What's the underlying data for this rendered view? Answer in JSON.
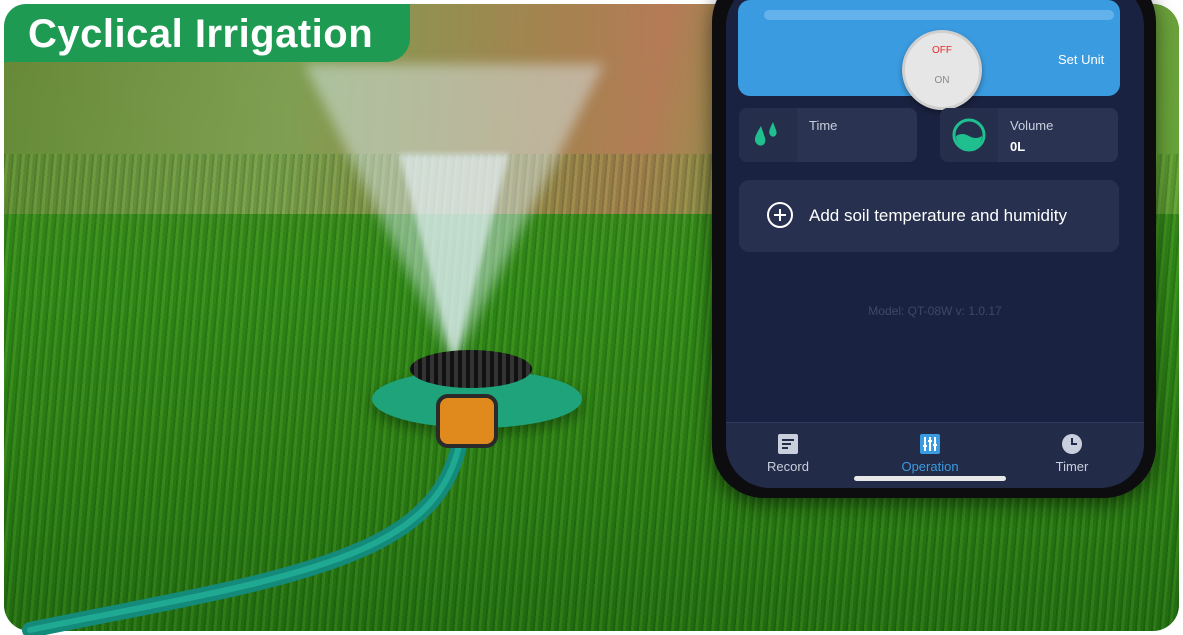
{
  "banner": {
    "title": "Cyclical Irrigation"
  },
  "device": {
    "power_toggle": {
      "off_label": "OFF",
      "on_label": "ON",
      "state": "off"
    },
    "set_unit_label": "Set Unit",
    "stats": [
      {
        "label": "Time",
        "value": "",
        "icon": "water-drops-icon"
      },
      {
        "label": "Volume",
        "value": "0L",
        "icon": "water-level-icon"
      }
    ],
    "add_sensor_label": "Add soil temperature and humidity",
    "model_text": "Model: QT-08W v: 1.0.17"
  },
  "nav": {
    "items": [
      {
        "label": "Record",
        "icon": "record-icon",
        "active": false
      },
      {
        "label": "Operation",
        "icon": "operation-icon",
        "active": true
      },
      {
        "label": "Timer",
        "icon": "timer-icon",
        "active": false
      }
    ]
  },
  "colors": {
    "brand_green": "#1f9a52",
    "accent_blue": "#3b9be0",
    "app_bg": "#1a2241",
    "icon_teal": "#1fbf8f"
  }
}
